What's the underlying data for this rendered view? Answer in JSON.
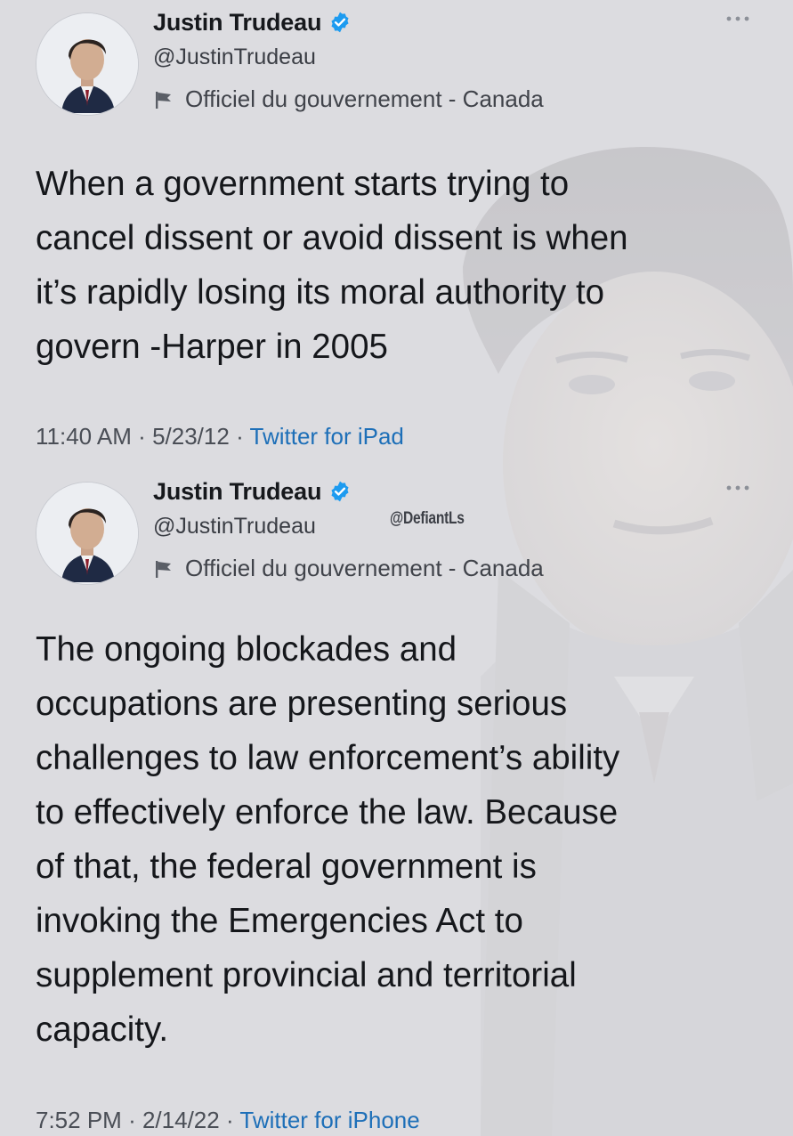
{
  "tweets": [
    {
      "author": {
        "name": "Justin Trudeau",
        "handle": "@JustinTrudeau",
        "label": "Officiel du gouvernement - Canada",
        "verified": true
      },
      "text": "When a government starts trying to\ncancel dissent or avoid dissent is when\nit’s rapidly losing its moral authority to\ngovern -Harper in 2005",
      "time": "11:40 AM",
      "date": "5/23/12",
      "separator": "·",
      "source": "Twitter for iPad"
    },
    {
      "author": {
        "name": "Justin Trudeau",
        "handle": "@JustinTrudeau",
        "label": "Officiel du gouvernement - Canada",
        "verified": true
      },
      "text": "The ongoing blockades and\noccupations are presenting serious\nchallenges to law enforcement’s ability\nto effectively enforce the law. Because\nof that, the federal government is\ninvoking the Emergencies Act to\nsupplement provincial and territorial\ncapacity.",
      "time": "7:52 PM",
      "date": "2/14/22",
      "separator": "·",
      "source": "Twitter for iPhone"
    }
  ],
  "watermark": "@DefiantLs",
  "icons": {
    "verified": "verified-badge-icon",
    "label": "flag-icon",
    "more": "more-dots-icon"
  },
  "colors": {
    "background": "#dcdce0",
    "verified": "#1d9bf0",
    "source_link": "#1d6fb8",
    "text": "#15171b"
  }
}
